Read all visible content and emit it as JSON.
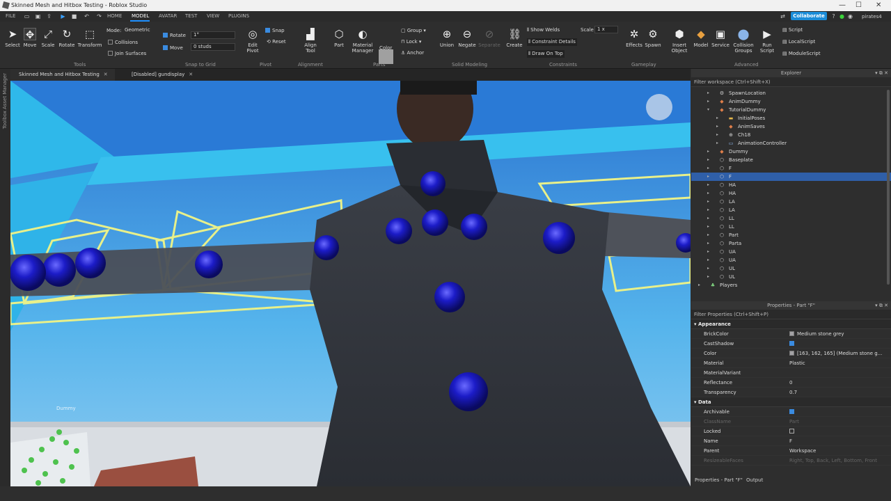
{
  "window": {
    "title": "Skinned Mesh and Hitbox Testing - Roblox Studio",
    "controls": [
      "—",
      "☐",
      "✕"
    ]
  },
  "menu": {
    "items": [
      "FILE",
      "HOME",
      "MODEL",
      "AVATAR",
      "TEST",
      "VIEW",
      "PLUGINS"
    ],
    "active": "MODEL",
    "collaborate": "Collaborate",
    "user": "pirates4"
  },
  "ribbon": {
    "tools": {
      "select": "Select",
      "move": "Move",
      "scale": "Scale",
      "rotate": "Rotate",
      "transform": "Transform",
      "mode_label": "Mode:",
      "mode_value": "Geometric",
      "collisions": "Collisions",
      "join_surfaces": "Join Surfaces",
      "group_label": "Tools"
    },
    "snap": {
      "rotate_label": "Rotate",
      "rotate_value": "1°",
      "move_label": "Move",
      "move_value": "0 studs",
      "group_label": "Snap to Grid"
    },
    "pivot": {
      "snap": "Snap",
      "reset": "Reset",
      "edit_pivot": "Edit Pivot",
      "group_label": "Pivot"
    },
    "alignment": {
      "align_tool": "Align Tool",
      "group_label": "Alignment"
    },
    "parts": {
      "part": "Part",
      "material_manager": "Material Manager",
      "color": "Color",
      "group": "Group",
      "lock": "Lock",
      "anchor": "Anchor",
      "group_label": "Parts"
    },
    "solid": {
      "union": "Union",
      "negate": "Negate",
      "separate": "Separate",
      "group_label": "Solid Modeling"
    },
    "constraints": {
      "create": "Create",
      "show_welds": "Show Welds",
      "constraint_details": "Constraint Details",
      "draw_on_top": "Draw On Top",
      "scale_label": "Scale",
      "scale_value": "1 x",
      "group_label": "Constraints"
    },
    "gameplay": {
      "effects": "Effects",
      "spawn": "Spawn",
      "group_label": "Gameplay"
    },
    "advanced": {
      "insert_object": "Insert Object",
      "model": "Model",
      "service": "Service",
      "collision_groups": "Collision Groups",
      "run_script": "Run Script",
      "script": "Script",
      "local_script": "LocalScript",
      "module_script": "ModuleScript",
      "group_label": "Advanced"
    }
  },
  "sidebar": {
    "asset_manager": "Asset Manager",
    "toolbox": "Toolbox"
  },
  "tabs": [
    {
      "label": "Skinned Mesh and Hitbox Testing",
      "close": "✕"
    },
    {
      "label": "[Disabled] gundisplay",
      "close": "✕"
    }
  ],
  "viewport": {
    "name_tag": "Dummy"
  },
  "explorer": {
    "title": "Explorer",
    "filter": "Filter workspace (Ctrl+Shift+X)",
    "items": [
      {
        "label": "SpawnLocation",
        "depth": 1,
        "icon": "spawn-icon",
        "color": "#cfcfcf"
      },
      {
        "label": "AnimDummy",
        "depth": 1,
        "icon": "model-icon",
        "color": "#e07f4a"
      },
      {
        "label": "TutorialDummy",
        "depth": 1,
        "icon": "model-icon",
        "color": "#e07f4a",
        "expanded": true
      },
      {
        "label": "InitialPoses",
        "depth": 2,
        "icon": "folder-icon",
        "color": "#e6b84a"
      },
      {
        "label": "AnimSaves",
        "depth": 2,
        "icon": "model-icon",
        "color": "#e07f4a"
      },
      {
        "label": "Ch18",
        "depth": 2,
        "icon": "mesh-icon",
        "color": "#cfcfcf"
      },
      {
        "label": "AnimationController",
        "depth": 2,
        "icon": "animation-icon",
        "color": "#8ab4e8"
      },
      {
        "label": "Dummy",
        "depth": 1,
        "icon": "model-icon",
        "color": "#e07f4a"
      },
      {
        "label": "Baseplate",
        "depth": 1,
        "icon": "part-icon",
        "color": "#cfcfcf"
      },
      {
        "label": "F",
        "depth": 1,
        "icon": "part-icon",
        "color": "#cfcfcf"
      },
      {
        "label": "F",
        "depth": 1,
        "icon": "part-icon",
        "color": "#cfcfcf",
        "selected": true
      },
      {
        "label": "HA",
        "depth": 1,
        "icon": "part-icon",
        "color": "#cfcfcf"
      },
      {
        "label": "HA",
        "depth": 1,
        "icon": "part-icon",
        "color": "#cfcfcf"
      },
      {
        "label": "LA",
        "depth": 1,
        "icon": "part-icon",
        "color": "#cfcfcf"
      },
      {
        "label": "LA",
        "depth": 1,
        "icon": "part-icon",
        "color": "#cfcfcf"
      },
      {
        "label": "LL",
        "depth": 1,
        "icon": "part-icon",
        "color": "#cfcfcf"
      },
      {
        "label": "LL",
        "depth": 1,
        "icon": "part-icon",
        "color": "#cfcfcf"
      },
      {
        "label": "Part",
        "depth": 1,
        "icon": "part-icon",
        "color": "#cfcfcf"
      },
      {
        "label": "Parta",
        "depth": 1,
        "icon": "part-icon",
        "color": "#cfcfcf"
      },
      {
        "label": "UA",
        "depth": 1,
        "icon": "part-icon",
        "color": "#cfcfcf"
      },
      {
        "label": "UA",
        "depth": 1,
        "icon": "part-icon",
        "color": "#cfcfcf"
      },
      {
        "label": "UL",
        "depth": 1,
        "icon": "part-icon",
        "color": "#cfcfcf"
      },
      {
        "label": "UL",
        "depth": 1,
        "icon": "part-icon",
        "color": "#cfcfcf"
      },
      {
        "label": "Players",
        "depth": 0,
        "icon": "players-icon",
        "color": "#7fd37f"
      }
    ]
  },
  "properties": {
    "title": "Properties - Part \"F\"",
    "filter": "Filter Properties (Ctrl+Shift+P)",
    "sections": [
      {
        "name": "Appearance",
        "rows": [
          {
            "name": "BrickColor",
            "value": "Medium stone grey",
            "swatch": "#a3a2a5"
          },
          {
            "name": "CastShadow",
            "check": true
          },
          {
            "name": "Color",
            "value": "[163, 162, 165] (Medium stone g...",
            "swatch": "#a3a2a5"
          },
          {
            "name": "Material",
            "value": "Plastic"
          },
          {
            "name": "MaterialVariant",
            "value": ""
          },
          {
            "name": "Reflectance",
            "value": "0"
          },
          {
            "name": "Transparency",
            "value": "0.7"
          }
        ]
      },
      {
        "name": "Data",
        "rows": [
          {
            "name": "Archivable",
            "check": true
          },
          {
            "name": "ClassName",
            "value": "Part",
            "dim": true
          },
          {
            "name": "Locked",
            "check": false
          },
          {
            "name": "Name",
            "value": "F"
          },
          {
            "name": "Parent",
            "value": "Workspace"
          },
          {
            "name": "ResizeableFaces",
            "value": "Right, Top, Back, Left, Bottom, Front",
            "dim": true
          }
        ]
      }
    ]
  },
  "bottom": {
    "tab_properties": "Properties - Part \"F\"",
    "tab_output": "Output"
  },
  "colors": {
    "accent": "#1a8cd8",
    "selection": "#2f5fa8",
    "sky": "#2fa9e6",
    "hitbox": "#e8f08a",
    "joint": "#1a1ad0"
  }
}
